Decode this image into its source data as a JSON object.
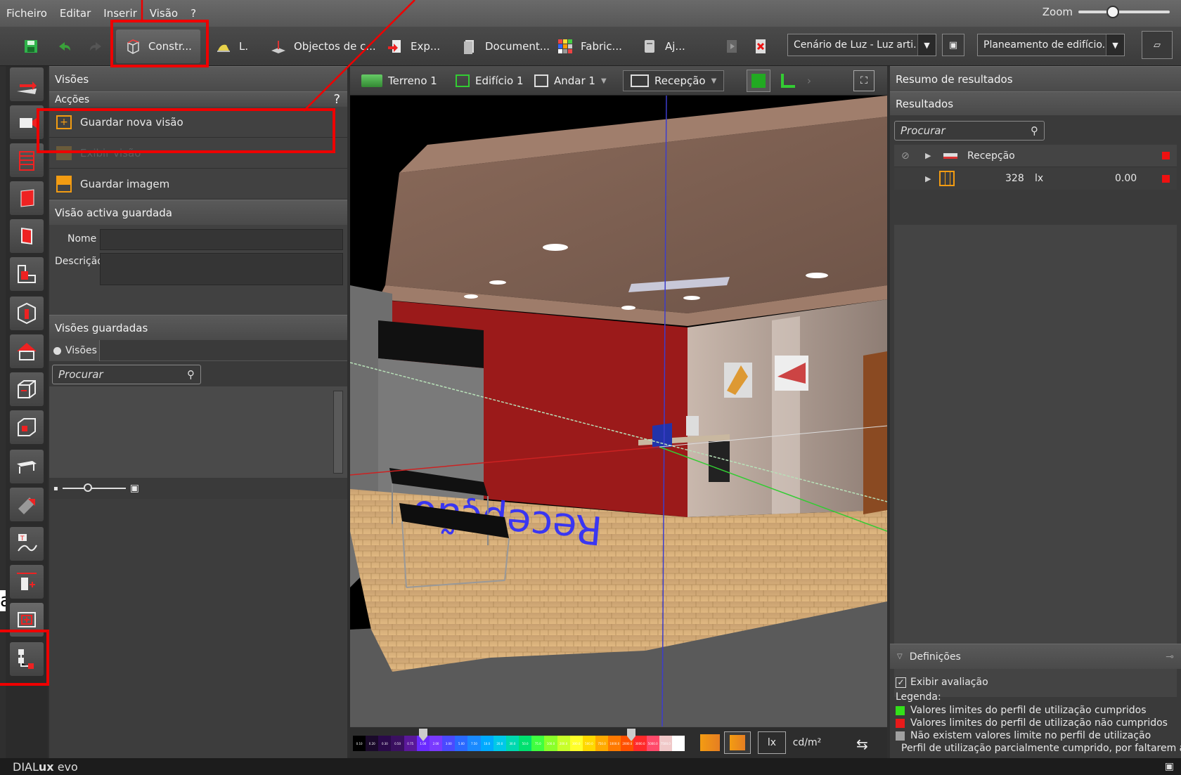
{
  "menubar": {
    "items": [
      "Ficheiro",
      "Editar",
      "Inserir",
      "Visão",
      "?"
    ],
    "zoom_label": "Zoom"
  },
  "toolbar": {
    "construction": "Constr...",
    "light": "L.",
    "objects": "Objectos de c...",
    "export": "Exp...",
    "documentation": "Document...",
    "manufacturers": "Fabric...",
    "help": "Aj...",
    "scene_dropdown": "Cenário de Luz - Luz arti...",
    "planning_dropdown": "Planeamento de edifício..."
  },
  "panel": {
    "title": "Visões",
    "actions_header": "Acções",
    "help_mark": "?",
    "save_new_view": "Guardar nova visão",
    "show_view": "Exibir visão",
    "save_image": "Guardar imagem",
    "active_view_header": "Visão activa guardada",
    "name_label": "Nome",
    "description_label": "Descrição",
    "saved_views_header": "Visões guardadas",
    "views_tab": "Visões",
    "search_placeholder": "Procurar"
  },
  "viewport": {
    "terrain": "Terreno 1",
    "building": "Edifício 1",
    "floor": "Andar 1",
    "room": "Recepção",
    "floor_text": "Recepção",
    "unit_lux": "lx",
    "unit_cdm2": "cd/m²",
    "scale_labels": [
      "0.10",
      "0.20",
      "0.30",
      "0.50",
      "0.75",
      "1.00",
      "2.00",
      "3.00",
      "5.00",
      "7.50",
      "10.0",
      "20.0",
      "30.0",
      "50.0",
      "75.0",
      "100.0",
      "200.0",
      "300.0",
      "500.0",
      "750.0",
      "1000.0",
      "2000.0",
      "3000.0",
      "5000.0",
      "7500.0",
      "10000.0"
    ]
  },
  "results": {
    "header": "Resumo de resultados",
    "subheader": "Resultados",
    "search_placeholder": "Procurar",
    "room_name": "Recepção",
    "value": "328",
    "unit": "lx",
    "uniformity": "0.00",
    "definitions_header": "Definições",
    "show_evaluation": "Exibir avaliação",
    "legend_title": "Legenda:",
    "legend": [
      {
        "text": "Valores limites do perfil de utilização cumpridos",
        "color": "#33e01a"
      },
      {
        "text": "Valores limites do perfil de utilização não cumpridos",
        "color": "#e81a1a"
      },
      {
        "text": "Não existem valores limite no perfil de utilização",
        "color": "#a0a0a0"
      },
      {
        "text": "Perfil de utilização parcialmente cumprido, por faltarem alg",
        "color": "#6bd030"
      }
    ]
  },
  "statusbar": {
    "brand_prefix": "DIAL",
    "brand_bold": "ux",
    "brand_suffix": " evo"
  },
  "annotation": {
    "stray_letter": "a"
  }
}
